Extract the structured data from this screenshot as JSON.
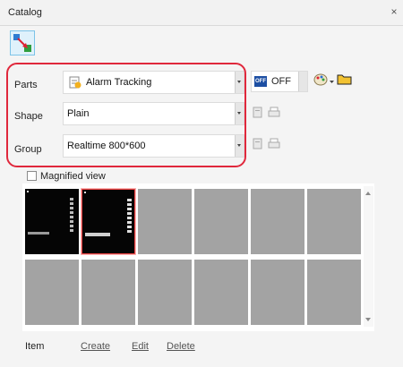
{
  "window": {
    "title": "Catalog",
    "close_glyph": "×"
  },
  "toolbar": {
    "tool_icon": "catalog-tool-icon"
  },
  "parts": {
    "label": "Parts",
    "value": "Alarm Tracking",
    "icon": "alarm-tracking-icon"
  },
  "shape": {
    "label": "Shape",
    "value": "Plain"
  },
  "group": {
    "label": "Group",
    "value": "Realtime 800*600"
  },
  "state_selector": {
    "badge": "OFF",
    "value": "OFF"
  },
  "magnified_view": {
    "label": "Magnified view",
    "checked": false
  },
  "gallery": {
    "items": [
      {
        "style": "dark-preview",
        "selected": false
      },
      {
        "style": "dark-preview",
        "selected": true
      },
      {
        "style": "empty",
        "selected": false
      },
      {
        "style": "empty",
        "selected": false
      },
      {
        "style": "empty",
        "selected": false
      },
      {
        "style": "empty",
        "selected": false
      },
      {
        "style": "empty",
        "selected": false
      },
      {
        "style": "empty",
        "selected": false
      },
      {
        "style": "empty",
        "selected": false
      },
      {
        "style": "empty",
        "selected": false
      },
      {
        "style": "empty",
        "selected": false
      },
      {
        "style": "empty",
        "selected": false
      }
    ]
  },
  "item_bar": {
    "label": "Item",
    "create": "Create",
    "edit": "Edit",
    "delete": "Delete"
  },
  "colors": {
    "highlight": "#e0283c",
    "thumb_empty": "#a3a3a3",
    "thumb_dark": "#050505"
  }
}
